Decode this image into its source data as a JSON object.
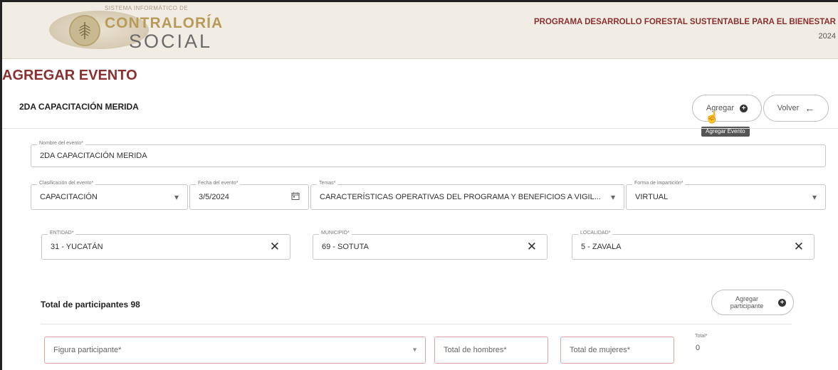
{
  "header": {
    "logo_small": "SISTEMA INFORMÁTICO DE",
    "logo_main": "CONTRALORÍA",
    "logo_sub": "SOCIAL",
    "program_title": "PROGRAMA DESARROLLO FORESTAL SUSTENTABLE PARA EL BIENESTAR",
    "year": "2024"
  },
  "page": {
    "title": "AGREGAR EVENTO",
    "event_title": "2DA CAPACITACIÓN MERIDA"
  },
  "toolbar": {
    "add_label": "Agregar",
    "back_label": "Volver",
    "tooltip": "Agregar Evento"
  },
  "form": {
    "nombre": {
      "label": "Nombre del evento*",
      "value": "2DA CAPACITACIÓN MERIDA"
    },
    "clasificacion": {
      "label": "Clasificación del evento*",
      "value": "CAPACITACIÓN"
    },
    "fecha": {
      "label": "Fecha del evento*",
      "value": "3/5/2024"
    },
    "temas": {
      "label": "Temas*",
      "value": "CARACTERÍSTICAS OPERATIVAS DEL PROGRAMA Y BENEFICIOS A VIGIL..."
    },
    "forma": {
      "label": "Forma de impartición*",
      "value": "VIRTUAL"
    },
    "entidad": {
      "label": "ENTIDAD*",
      "value": "31 - YUCATÁN"
    },
    "municipio": {
      "label": "MUNICIPIO*",
      "value": "69 - SOTUTA"
    },
    "localidad": {
      "label": "LOCALIDAD*",
      "value": "5 - ZAVALA"
    }
  },
  "participants": {
    "title": "Total de participantes 98",
    "add_label": "Agregar participante",
    "figura_placeholder": "Figura participante*",
    "hombres_placeholder": "Total de hombres*",
    "mujeres_placeholder": "Total de mujeres*",
    "total_label": "Total*",
    "total_value": "0"
  },
  "icons": {
    "dropdown": "chevron-down-icon",
    "calendar": "calendar-icon",
    "clear": "close-icon",
    "add": "plus-circle-icon",
    "back": "arrow-left-icon"
  },
  "colors": {
    "brand": "#8a3030",
    "header_bg": "#f1ede4",
    "gold": "#b89a5a",
    "error_border": "#e0a3a3"
  }
}
